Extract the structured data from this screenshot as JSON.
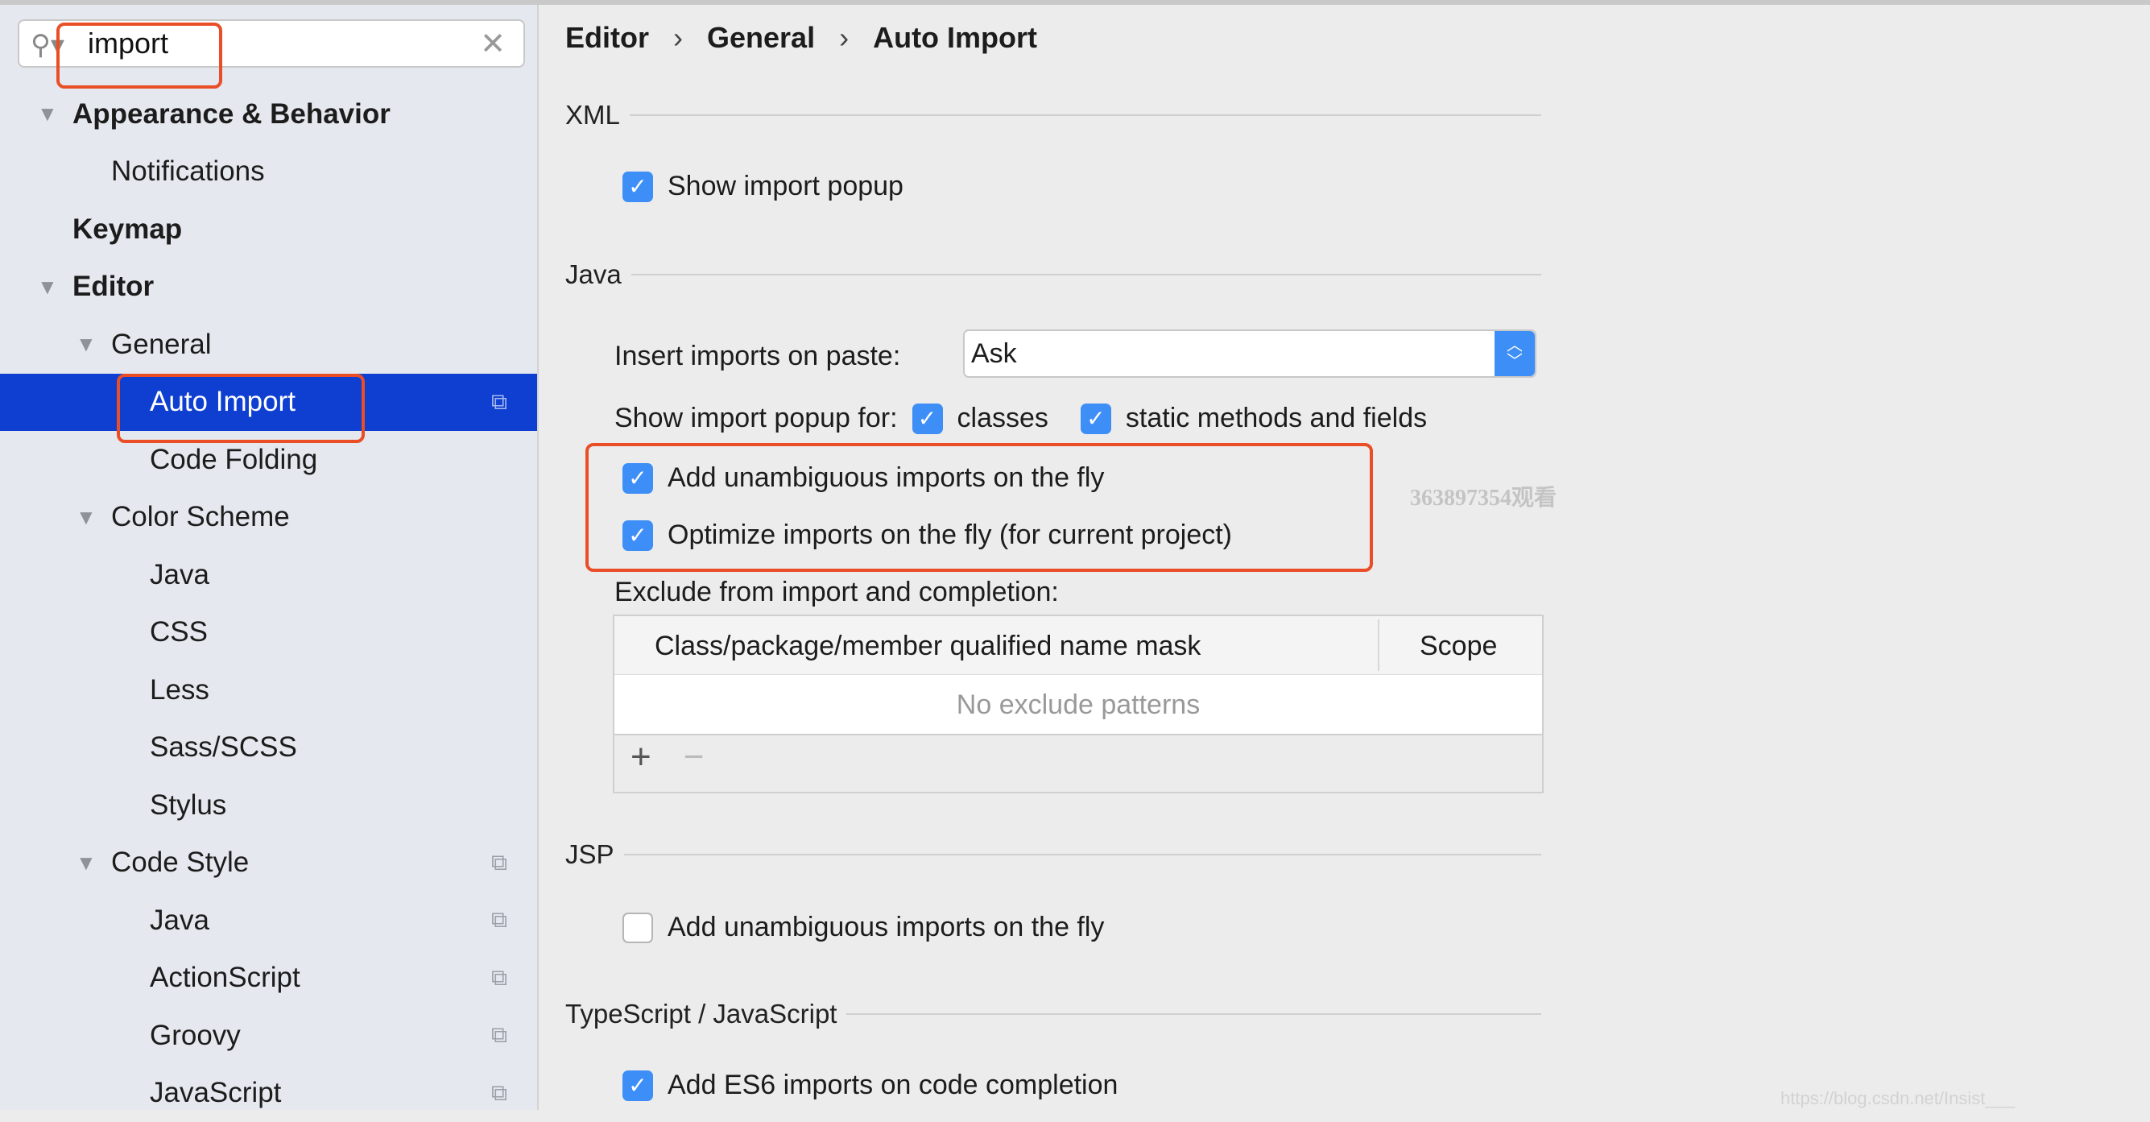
{
  "search": {
    "value": "import",
    "icon": "search-icon",
    "clear_icon": "close-icon"
  },
  "sidebar": {
    "items": [
      {
        "label": "Appearance & Behavior",
        "level": 0,
        "bold": true,
        "expanded": true
      },
      {
        "label": "Notifications",
        "level": 1
      },
      {
        "label": "Keymap",
        "level": 0,
        "bold": true
      },
      {
        "label": "Editor",
        "level": 0,
        "bold": true,
        "expanded": true
      },
      {
        "label": "General",
        "level": 1,
        "expanded": true
      },
      {
        "label": "Auto Import",
        "level": 2,
        "selected": true,
        "copy": true
      },
      {
        "label": "Code Folding",
        "level": 2
      },
      {
        "label": "Color Scheme",
        "level": 1,
        "expanded": true
      },
      {
        "label": "Java",
        "level": 2
      },
      {
        "label": "CSS",
        "level": 2
      },
      {
        "label": "Less",
        "level": 2
      },
      {
        "label": "Sass/SCSS",
        "level": 2
      },
      {
        "label": "Stylus",
        "level": 2
      },
      {
        "label": "Code Style",
        "level": 1,
        "expanded": true,
        "copy": true
      },
      {
        "label": "Java",
        "level": 2,
        "copy": true
      },
      {
        "label": "ActionScript",
        "level": 2,
        "copy": true
      },
      {
        "label": "Groovy",
        "level": 2,
        "copy": true
      },
      {
        "label": "JavaScript",
        "level": 2,
        "copy": true
      }
    ]
  },
  "breadcrumb": [
    "Editor",
    "General",
    "Auto Import"
  ],
  "breadcrumb_sep": "›",
  "xml": {
    "title": "XML",
    "show_popup": {
      "label": "Show import popup",
      "checked": true
    }
  },
  "java": {
    "title": "Java",
    "insert_label": "Insert imports on paste:",
    "insert_value": "Ask",
    "popup_for_label": "Show import popup for:",
    "classes": {
      "label": "classes",
      "checked": true
    },
    "static": {
      "label": "static methods and fields",
      "checked": true
    },
    "unambiguous": {
      "label": "Add unambiguous imports on the fly",
      "checked": true
    },
    "optimize": {
      "label": "Optimize imports on the fly (for current project)",
      "checked": true
    },
    "exclude_label": "Exclude from import and completion:",
    "table": {
      "columns": [
        "Class/package/member qualified name mask",
        "Scope"
      ],
      "empty": "No exclude patterns",
      "add": "+",
      "remove": "−"
    }
  },
  "jsp": {
    "title": "JSP",
    "unambiguous": {
      "label": "Add unambiguous imports on the fly",
      "checked": false
    }
  },
  "ts": {
    "title": "TypeScript / JavaScript",
    "es6": {
      "label": "Add ES6 imports on code completion",
      "checked": true
    }
  },
  "watermarks": {
    "viewer": "363897354观看",
    "url": "https://blog.csdn.net/Insist___"
  },
  "colors": {
    "selection": "#0f3fd0",
    "checkbox": "#3d8ef7",
    "highlight": "#e94e27"
  }
}
